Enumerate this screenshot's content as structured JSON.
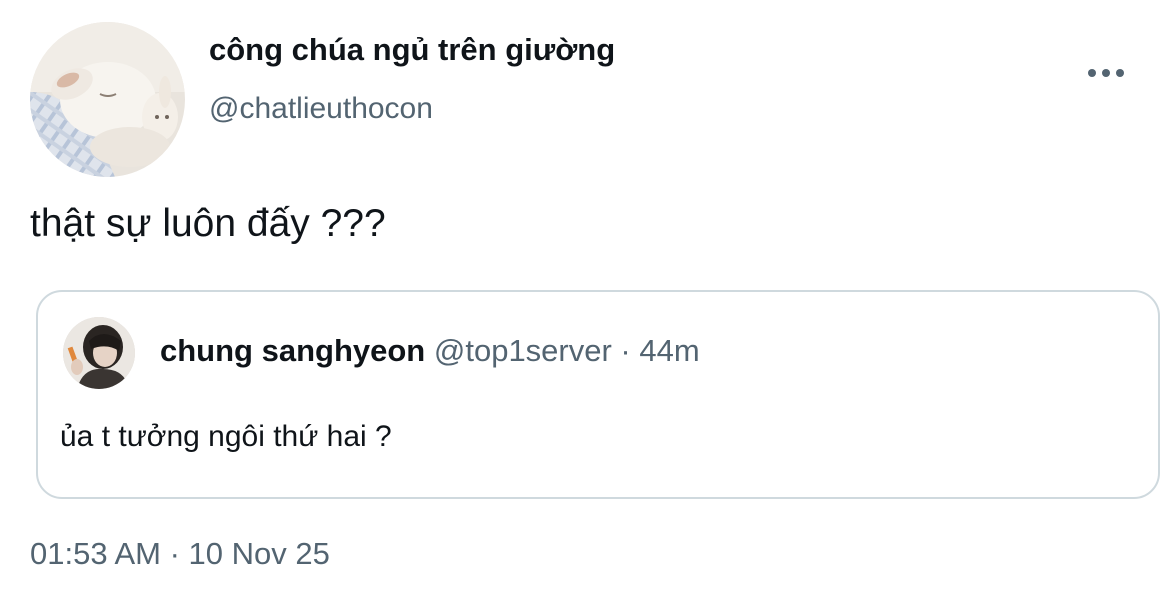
{
  "author": {
    "display_name": "công chúa ngủ trên giường",
    "handle": "@chatlieuthocon",
    "avatar": "sleeping-bunny-avatar"
  },
  "tweet": {
    "text": "thật sự luôn đấy ???",
    "timestamp": "01:53 AM",
    "separator": " · ",
    "date": "10 Nov 25"
  },
  "more_icon": "more-dots-icon",
  "quote": {
    "display_name": "chung sanghyeon",
    "handle": "@top1server",
    "separator": " · ",
    "time_ago": "44m",
    "text": "ủa t tưởng ngôi thứ hai ?",
    "avatar": "person-avatar"
  },
  "colors": {
    "text_primary": "#0f1419",
    "text_secondary": "#536471",
    "border": "#cfd9de",
    "background": "#ffffff"
  }
}
